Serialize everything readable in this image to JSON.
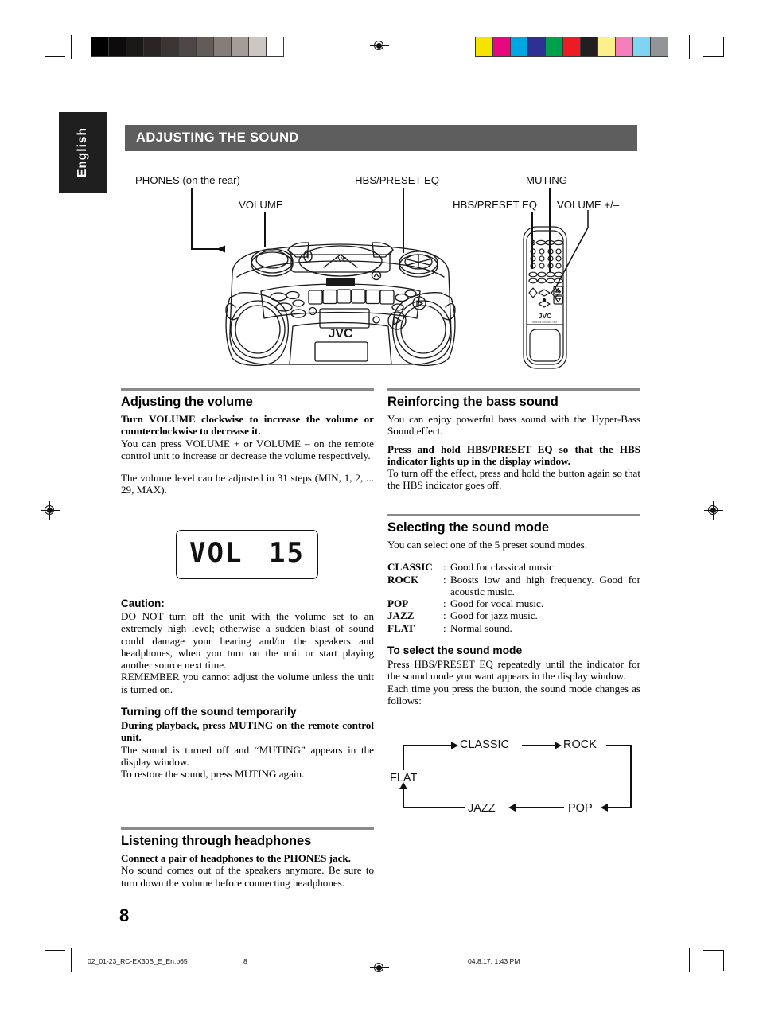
{
  "page": {
    "language_tab": "English",
    "section_title": "ADJUSTING THE SOUND",
    "page_number": "8"
  },
  "callouts": {
    "phones": "PHONES (on the rear)",
    "volume": "VOLUME",
    "hbs_preset_eq_unit": "HBS/PRESET EQ",
    "muting": "MUTING",
    "hbs_preset_eq_remote": "HBS/PRESET EQ",
    "volume_plus_minus": "VOLUME +/–"
  },
  "artwork": {
    "unit_brand": "JVC",
    "unit_top_brand": "JVC",
    "unit_mp3_badge": "MP3",
    "remote_brand": "JVC",
    "remote_sub": "REMOTE CONTROL UNIT RM-SRCEX30A"
  },
  "left_column": {
    "volume": {
      "heading": "Adjusting the volume",
      "bold_line": "Turn VOLUME clockwise to increase the volume or counterclockwise to decrease it.",
      "para1": "You can press VOLUME + or VOLUME – on the remote control unit to increase or decrease the volume respectively.",
      "para2": "The volume level can be adjusted in 31 steps (MIN, 1, 2, ... 29, MAX)."
    },
    "lcd": {
      "label": "VOL",
      "value": "15"
    },
    "caution": {
      "heading": "Caution:",
      "para1": "DO NOT turn off the unit with the volume set to an extremely high level; otherwise a sudden blast of sound could damage your hearing and/or the speakers and headphones, when you turn on the unit or start playing another source next time.",
      "para2": "REMEMBER you cannot adjust the volume unless the unit is turned on."
    },
    "muting": {
      "heading": "Turning off the sound temporarily",
      "bold_line": "During playback, press MUTING on the remote control unit.",
      "para1": "The sound is turned off and “MUTING” appears in the display window.",
      "para2": "To restore the sound, press MUTING again."
    },
    "headphones": {
      "heading": "Listening through headphones",
      "bold_line": "Connect a pair of headphones to the PHONES jack.",
      "para1": "No sound comes out of the speakers anymore. Be sure to turn down the volume before connecting headphones."
    }
  },
  "right_column": {
    "bass": {
      "heading": "Reinforcing the bass sound",
      "para1": "You can enjoy powerful bass sound with the Hyper-Bass Sound effect.",
      "bold_line": "Press and hold HBS/PRESET EQ so that the HBS indicator lights up in the display window.",
      "para2": "To turn off the effect, press and hold the button again so that the HBS indicator goes off."
    },
    "sound_mode": {
      "heading": "Selecting the sound mode",
      "intro": "You can select one of the 5 preset sound modes.",
      "modes": [
        {
          "name": "CLASSIC",
          "colon": ":",
          "desc": "Good for classical music."
        },
        {
          "name": "ROCK",
          "colon": ":",
          "desc": "Boosts low and high frequency. Good for acoustic music."
        },
        {
          "name": "POP",
          "colon": ":",
          "desc": "Good for vocal music."
        },
        {
          "name": "JAZZ",
          "colon": ":",
          "desc": "Good for jazz music."
        },
        {
          "name": "FLAT",
          "colon": ":",
          "desc": "Normal sound."
        }
      ],
      "select_heading": "To select the sound mode",
      "select_para1": "Press HBS/PRESET EQ repeatedly until the indicator for the sound mode you want appears in the display window.",
      "select_para2": "Each time you press the button, the sound mode changes as follows:"
    },
    "flow": {
      "nodes": [
        "FLAT",
        "CLASSIC",
        "ROCK",
        "POP",
        "JAZZ"
      ],
      "order_note": "FLAT → CLASSIC → ROCK → POP → JAZZ → FLAT"
    }
  },
  "footer": {
    "filename": "02_01-23_RC-EX30B_E_En.p65",
    "page": "8",
    "timestamp": "04.8.17, 1:43 PM"
  },
  "print_marks": {
    "grayscale_patches": [
      "#000000",
      "#0d0b0b",
      "#1b1818",
      "#2a2524",
      "#3b3533",
      "#4e4745",
      "#635b58",
      "#867d7a",
      "#a59c98",
      "#cdc6c2",
      "#ffffff"
    ],
    "color_patches": [
      "#f5e400",
      "#e9077f",
      "#00a6e2",
      "#2e3192",
      "#00a14b",
      "#ed1c24",
      "#231f20",
      "#fbf08a",
      "#f47dbb",
      "#7fd4f4",
      "#929497"
    ]
  }
}
